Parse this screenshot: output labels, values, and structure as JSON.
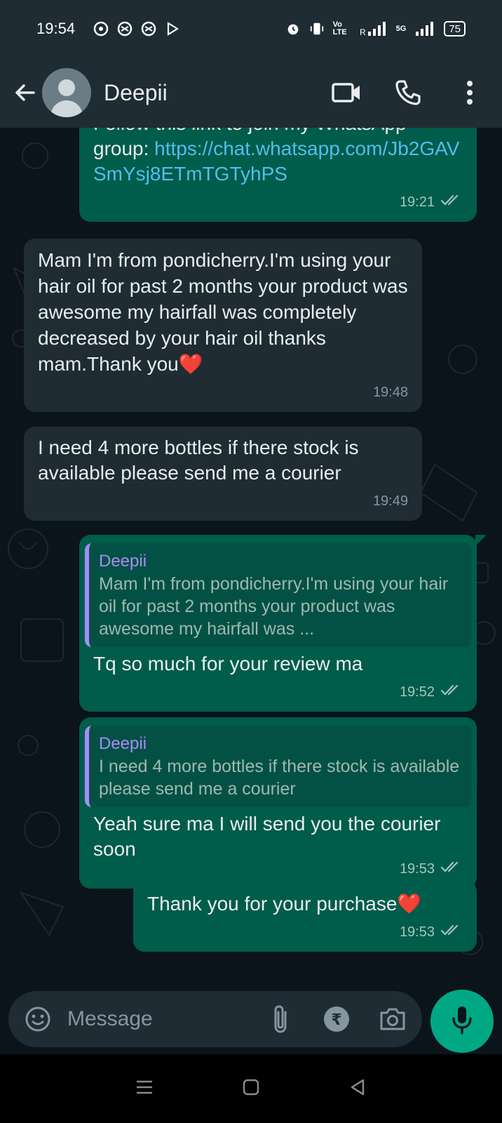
{
  "status_bar": {
    "time": "19:54",
    "battery": "75",
    "volte": "Vo LTE",
    "network_5g": "5G"
  },
  "header": {
    "contact_name": "Deepii",
    "icons": [
      "back-arrow-icon",
      "avatar",
      "video-call-icon",
      "phone-icon",
      "more-vert-icon"
    ]
  },
  "messages": [
    {
      "direction": "out",
      "text_prefix": "Follow this link to join my WhatsApp group: ",
      "link": "https://chat.whatsapp.com/Jb2GAVSmYsj8ETmTGTyhPS",
      "time": "19:21"
    },
    {
      "direction": "in",
      "text": "Mam I'm from pondicherry.I'm using your hair oil for past 2 months your product was awesome my hairfall was completely decreased by your hair oil thanks mam.Thank you",
      "emoji": "❤️",
      "time": "19:48"
    },
    {
      "direction": "in",
      "text": "I need 4 more bottles if there stock is available please send me a courier",
      "time": "19:49"
    },
    {
      "direction": "out",
      "quote_author": "Deepii",
      "quote_text": "Mam I'm from pondicherry.I'm using your hair oil for past 2 months your product was awesome my hairfall was ...",
      "text": "Tq so much for your review ma",
      "time": "19:52"
    },
    {
      "direction": "out",
      "quote_author": "Deepii",
      "quote_text": "I need 4 more bottles if there stock is available please send me a courier",
      "text": "Yeah sure ma I will send you the courier soon",
      "time": "19:53"
    },
    {
      "direction": "out",
      "text": "Thank you for your purchase",
      "emoji": "❤️",
      "time": "19:53"
    }
  ],
  "composer": {
    "placeholder": "Message",
    "icons": [
      "emoji-icon",
      "attach-icon",
      "rupee-payment-icon",
      "camera-icon",
      "mic-icon"
    ]
  },
  "colors": {
    "background": "#0b141a",
    "header": "#1f2c34",
    "incoming_bubble": "#1f2c34",
    "outgoing_bubble": "#005c4b",
    "accent": "#00a884",
    "link": "#53bdeb",
    "read_ticks": "#a6c4bd"
  }
}
